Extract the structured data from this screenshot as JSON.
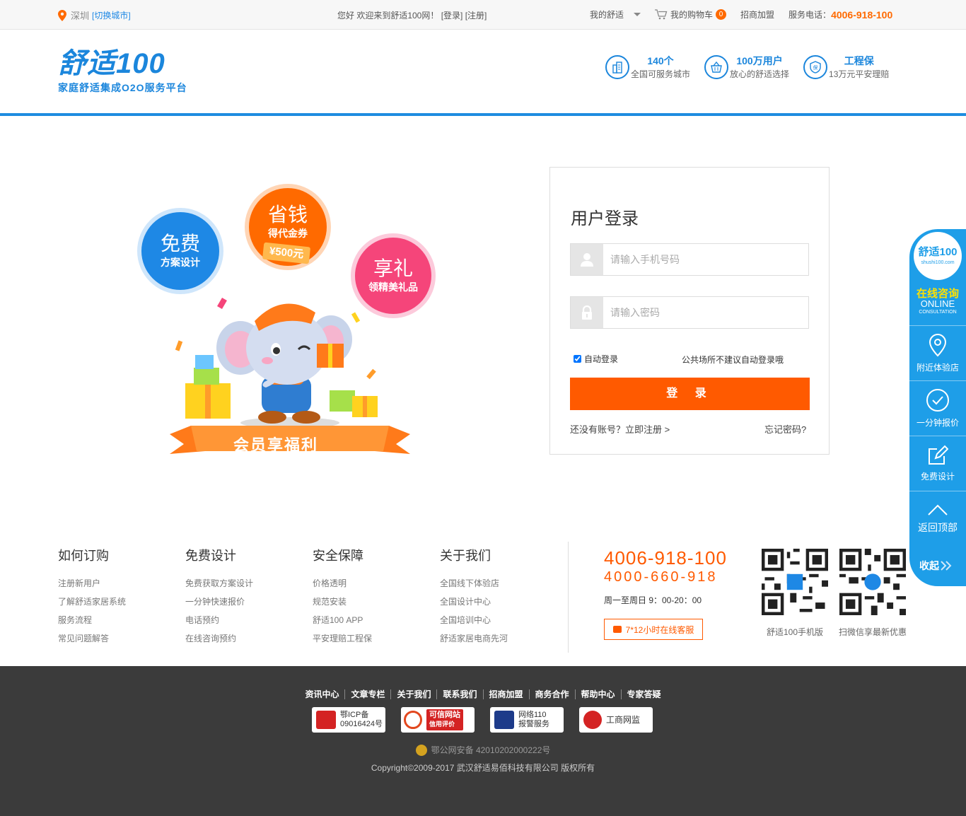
{
  "topbar": {
    "city": "深圳",
    "switch_city": "[切换城市]",
    "welcome": "您好 欢迎来到舒适100网！",
    "login_link": "[登录]",
    "register_link": "[注册]",
    "my_shushi": "我的舒适",
    "cart": "我的购物车",
    "cart_count": "0",
    "franchise": "招商加盟",
    "service_phone_label": "服务电话：",
    "service_phone": "4006-918-100"
  },
  "header": {
    "brand": "舒适100",
    "slogan": "家庭舒适集成O2O服务平台",
    "features": [
      {
        "title": "140个",
        "desc": "全国可服务城市",
        "icon": "city-icon"
      },
      {
        "title": "100万用户",
        "desc": "放心的舒适选择",
        "icon": "basket-icon"
      },
      {
        "title": "工程保",
        "desc": "13万元平安理赔",
        "icon": "shield-icon"
      }
    ]
  },
  "promo": {
    "free_big": "免费",
    "free_small": "方案设计",
    "save_big": "省钱",
    "save_small": "得代金券",
    "coupon": "¥500元",
    "gift_big": "享礼",
    "gift_small": "领精美礼品",
    "ribbon": "会员享福利"
  },
  "login": {
    "title": "用户登录",
    "phone_placeholder": "请输入手机号码",
    "password_placeholder": "请输入密码",
    "auto_login": "自动登录",
    "hint": "公共场所不建议自动登录哦",
    "submit": "登 录",
    "register": "还没有账号？立即注册 >",
    "forgot": "忘记密码?"
  },
  "floatbar": {
    "logo": "舒适100",
    "logo_url": "shushi100.com",
    "online": "在线咨询",
    "online_en": "ONLINE",
    "consultation": "CONSULTATION",
    "items": [
      "附近体验店",
      "一分钟报价",
      "免费设计",
      "返回顶部"
    ],
    "collapse": "收起"
  },
  "footer": {
    "columns": [
      {
        "title": "如何订购",
        "links": [
          "注册新用户",
          "了解舒适家居系统",
          "服务流程",
          "常见问题解答"
        ]
      },
      {
        "title": "免费设计",
        "links": [
          "免费获取方案设计",
          "一分钟快速报价",
          "电话预约",
          "在线咨询预约"
        ]
      },
      {
        "title": "安全保障",
        "links": [
          "价格透明",
          "规范安装",
          "舒适100 APP",
          "平安理赔工程保"
        ]
      },
      {
        "title": "关于我们",
        "links": [
          "全国线下体验店",
          "全国设计中心",
          "全国培训中心",
          "舒适家居电商先河"
        ]
      }
    ],
    "phone1": "4006-918-100",
    "phone2": "4000-660-918",
    "hours": "周一至周日 9：00-20：00",
    "chat": "7*12小时在线客服",
    "qr1_label": "舒适100手机版",
    "qr2_label": "扫微信享最新优惠"
  },
  "bottom": {
    "links": [
      "资讯中心",
      "文章专栏",
      "关于我们",
      "联系我们",
      "招商加盟",
      "商务合作",
      "帮助中心",
      "专家答疑"
    ],
    "badges": [
      {
        "line1": "鄂ICP备",
        "line2": "09016424号"
      },
      {
        "line1": "可信网站",
        "line2": "信用评价"
      },
      {
        "line1": "网络110",
        "line2": "报警服务"
      },
      {
        "line1": "工商网监",
        "line2": ""
      }
    ],
    "police": "鄂公网安备 42010202000222号",
    "copyright": "Copyright©2009-2017  武汉舒适易佰科技有限公司  版权所有"
  },
  "colors": {
    "brand_blue": "#1b86dc",
    "accent_orange": "#ff5a00",
    "float_blue": "#1e9ee8",
    "footer_dark": "#3b3b3b"
  }
}
